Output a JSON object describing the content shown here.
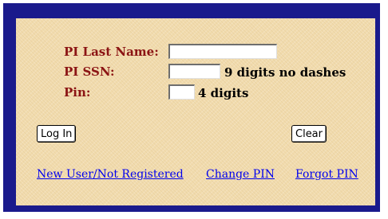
{
  "login_form": {
    "last_name_label": "PI Last Name:",
    "last_name_value": "",
    "ssn_label": "PI SSN:",
    "ssn_value": "",
    "ssn_hint": "9 digits no dashes",
    "pin_label": "Pin:",
    "pin_value": "",
    "pin_hint": "4 digits"
  },
  "buttons": {
    "login_label": "Log In",
    "clear_label": "Clear"
  },
  "links": {
    "new_user": "New User/Not Registered",
    "change_pin": "Change PIN",
    "forgot_pin": "Forgot PIN"
  },
  "colors": {
    "frame": "#1a1a8c",
    "panel": "#f2dcae",
    "label_text": "#8b1414",
    "link_text": "#0000ee"
  }
}
